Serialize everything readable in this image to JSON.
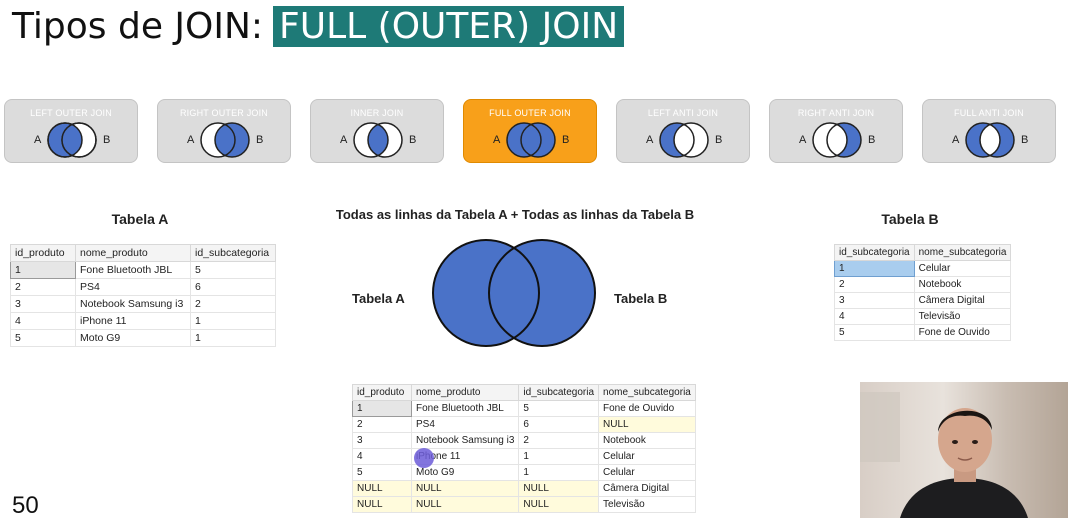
{
  "title": {
    "prefix": "Tipos de JOIN:",
    "highlight": "FULL (OUTER) JOIN"
  },
  "joins": [
    {
      "label": "LEFT OUTER JOIN",
      "fill": "left",
      "active": false
    },
    {
      "label": "RIGHT OUTER JOIN",
      "fill": "right",
      "active": false
    },
    {
      "label": "INNER JOIN",
      "fill": "inner",
      "active": false
    },
    {
      "label": "FULL OUTER JOIN",
      "fill": "full",
      "active": true
    },
    {
      "label": "LEFT ANTI JOIN",
      "fill": "left-anti",
      "active": false
    },
    {
      "label": "RIGHT ANTI JOIN",
      "fill": "right-anti",
      "active": false
    },
    {
      "label": "FULL ANTI JOIN",
      "fill": "full-anti",
      "active": false
    }
  ],
  "set_labels": {
    "a": "A",
    "b": "B"
  },
  "tabela_a": {
    "caption": "Tabela A",
    "columns": [
      "id_produto",
      "nome_produto",
      "id_subcategoria"
    ],
    "rows": [
      [
        "1",
        "Fone Bluetooth JBL",
        "5"
      ],
      [
        "2",
        "PS4",
        "6"
      ],
      [
        "3",
        "Notebook Samsung i3",
        "2"
      ],
      [
        "4",
        "iPhone 11",
        "1"
      ],
      [
        "5",
        "Moto G9",
        "1"
      ]
    ]
  },
  "tabela_b": {
    "caption": "Tabela B",
    "columns": [
      "id_subcategoria",
      "nome_subcategoria"
    ],
    "rows": [
      [
        "1",
        "Celular"
      ],
      [
        "2",
        "Notebook"
      ],
      [
        "3",
        "Câmera Digital"
      ],
      [
        "4",
        "Televisão"
      ],
      [
        "5",
        "Fone de Ouvido"
      ]
    ]
  },
  "venn": {
    "caption": "Todas as linhas da Tabela A + Todas as linhas da Tabela B",
    "left_label": "Tabela A",
    "right_label": "Tabela B"
  },
  "result": {
    "columns": [
      "id_produto",
      "nome_produto",
      "id_subcategoria",
      "nome_subcategoria"
    ],
    "rows": [
      [
        "1",
        "Fone Bluetooth JBL",
        "5",
        "Fone de Ouvido"
      ],
      [
        "2",
        "PS4",
        "6",
        "NULL"
      ],
      [
        "3",
        "Notebook Samsung i3",
        "2",
        "Notebook"
      ],
      [
        "4",
        "iPhone 11",
        "1",
        "Celular"
      ],
      [
        "5",
        "Moto G9",
        "1",
        "Celular"
      ],
      [
        "NULL",
        "NULL",
        "NULL",
        "Câmera Digital"
      ],
      [
        "NULL",
        "NULL",
        "NULL",
        "Televisão"
      ]
    ]
  },
  "page_number": "50",
  "colors": {
    "accent": "#1e7a77",
    "active_card": "#f8a01a",
    "venn_fill": "#4a72c8",
    "null_bg": "#fffbdc"
  }
}
